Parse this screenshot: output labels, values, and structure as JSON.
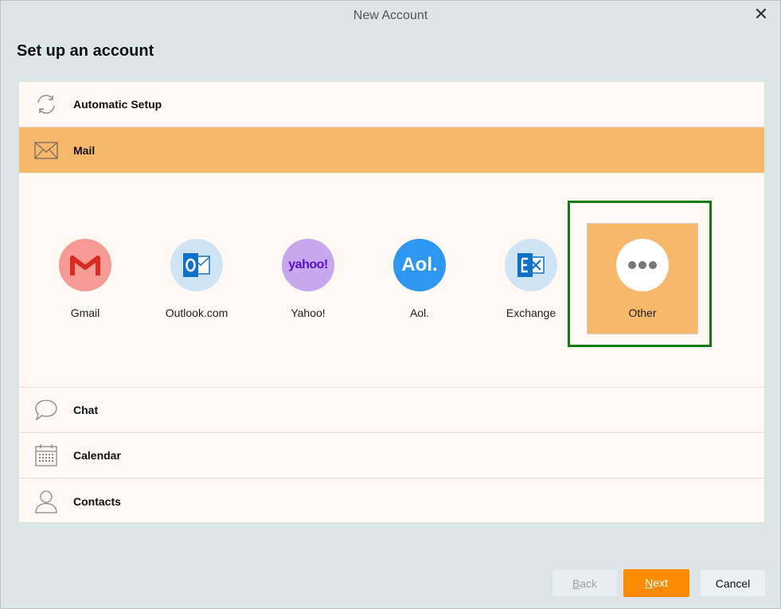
{
  "window": {
    "title": "New Account",
    "close_glyph": "✕"
  },
  "heading": "Set up an account",
  "sections": {
    "automatic": {
      "label": "Automatic Setup",
      "icon": "refresh-icon"
    },
    "mail": {
      "label": "Mail",
      "icon": "envelope-icon",
      "active": true
    },
    "chat": {
      "label": "Chat",
      "icon": "speech-bubble-icon"
    },
    "calendar": {
      "label": "Calendar",
      "icon": "calendar-icon"
    },
    "contacts": {
      "label": "Contacts",
      "icon": "person-icon"
    }
  },
  "providers": [
    {
      "label": "Gmail",
      "icon": "gmail-icon",
      "color": "#f59a95"
    },
    {
      "label": "Outlook.com",
      "icon": "outlook-icon",
      "color": "#cfe4f4"
    },
    {
      "label": "Yahoo!",
      "icon": "yahoo-icon",
      "color": "#c8a7ef",
      "logo_text": "yahoo!"
    },
    {
      "label": "Aol.",
      "icon": "aol-icon",
      "color": "#2e97f0",
      "logo_text": "Aol."
    },
    {
      "label": "Exchange",
      "icon": "exchange-icon",
      "color": "#cfe4f4"
    },
    {
      "label": "Other",
      "icon": "more-dots-icon",
      "color": "#ffffff",
      "selected": true
    }
  ],
  "buttons": {
    "back": {
      "prefix": "",
      "mnemonic": "B",
      "rest": "ack",
      "enabled": false
    },
    "next": {
      "prefix": "",
      "mnemonic": "N",
      "rest": "ext",
      "enabled": true
    },
    "cancel": {
      "label": "Cancel"
    }
  },
  "colors": {
    "accent_orange": "#ff8c00",
    "selected_row": "#f6b86b",
    "focus_ring": "#137a13"
  }
}
